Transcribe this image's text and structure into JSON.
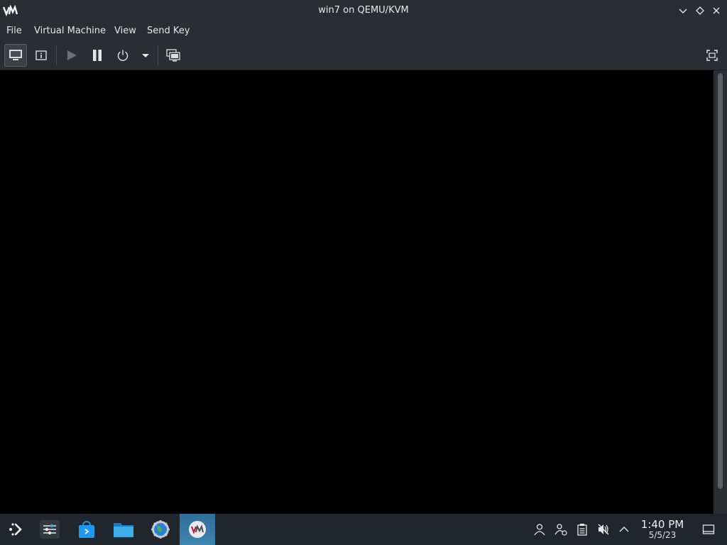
{
  "window": {
    "title": "win7 on QEMU/KVM",
    "logo_text": "VM"
  },
  "menubar": {
    "items": [
      "File",
      "Virtual Machine",
      "View",
      "Send Key"
    ]
  },
  "toolbar": {
    "buttons": [
      {
        "name": "show-console-button",
        "icon": "monitor-icon",
        "active": true
      },
      {
        "name": "show-details-button",
        "icon": "info-icon"
      },
      {
        "name": "run-button",
        "icon": "play-icon",
        "disabled": true
      },
      {
        "name": "pause-button",
        "icon": "pause-icon"
      },
      {
        "name": "shutdown-button",
        "icon": "power-icon"
      },
      {
        "name": "shutdown-menu-button",
        "icon": "caret-down-icon"
      },
      {
        "name": "snapshots-button",
        "icon": "snapshots-icon"
      },
      {
        "name": "fullscreen-button",
        "icon": "fullscreen-icon"
      }
    ]
  },
  "taskbar": {
    "apps": [
      {
        "name": "app-launcher",
        "icon": "kde-launcher-icon"
      },
      {
        "name": "task-system-settings",
        "icon": "sliders-icon"
      },
      {
        "name": "task-discover",
        "icon": "store-bag-icon"
      },
      {
        "name": "task-file-manager",
        "icon": "folder-icon"
      },
      {
        "name": "task-browser",
        "icon": "globe-gear-icon"
      },
      {
        "name": "task-virt-manager",
        "icon": "vm-icon",
        "active": true
      }
    ],
    "tray": [
      "user-icon",
      "network-user-icon",
      "clipboard-icon",
      "volume-muted-icon",
      "chevron-up-icon"
    ],
    "clock": {
      "time": "1:40 PM",
      "date": "5/5/23"
    },
    "show_desktop_icon": "show-desktop-icon"
  },
  "colors": {
    "chrome": "#2a2e32",
    "taskbar": "#20262b",
    "active_task": "#3d85b0",
    "viewer": "#000000"
  }
}
